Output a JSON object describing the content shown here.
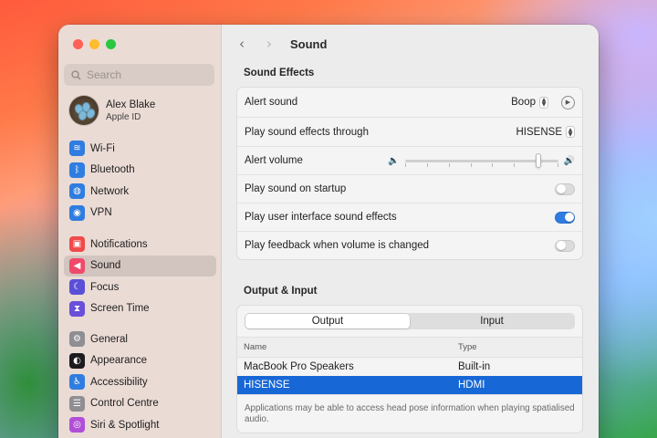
{
  "sidebar": {
    "search_placeholder": "Search",
    "account": {
      "name": "Alex Blake",
      "subtitle": "Apple ID"
    },
    "groups": [
      [
        {
          "label": "Wi-Fi",
          "icon": "wifi-icon",
          "color": "#2f7de1",
          "glyph": "≋"
        },
        {
          "label": "Bluetooth",
          "icon": "bluetooth-icon",
          "color": "#2f7de1",
          "glyph": "ᛒ"
        },
        {
          "label": "Network",
          "icon": "network-icon",
          "color": "#2f7de1",
          "glyph": "◍"
        },
        {
          "label": "VPN",
          "icon": "vpn-icon",
          "color": "#2f7de1",
          "glyph": "◉"
        }
      ],
      [
        {
          "label": "Notifications",
          "icon": "notifications-icon",
          "color": "#f04a4a",
          "glyph": "▣"
        },
        {
          "label": "Sound",
          "icon": "sound-icon",
          "color": "#f04a6a",
          "glyph": "◀",
          "active": true
        },
        {
          "label": "Focus",
          "icon": "focus-icon",
          "color": "#5b4fd8",
          "glyph": "☾"
        },
        {
          "label": "Screen Time",
          "icon": "screen-time-icon",
          "color": "#6a4fd8",
          "glyph": "⧗"
        }
      ],
      [
        {
          "label": "General",
          "icon": "general-icon",
          "color": "#8e8e93",
          "glyph": "⚙"
        },
        {
          "label": "Appearance",
          "icon": "appearance-icon",
          "color": "#1c1c1e",
          "glyph": "◐"
        },
        {
          "label": "Accessibility",
          "icon": "accessibility-icon",
          "color": "#2f7de1",
          "glyph": "♿"
        },
        {
          "label": "Control Centre",
          "icon": "control-centre-icon",
          "color": "#8e8e93",
          "glyph": "☰"
        },
        {
          "label": "Siri & Spotlight",
          "icon": "siri-icon",
          "color": "#b04fd8",
          "glyph": "◎"
        }
      ]
    ]
  },
  "main": {
    "title": "Sound",
    "sound_effects": {
      "section_title": "Sound Effects",
      "alert_sound_label": "Alert sound",
      "alert_sound_value": "Boop",
      "output_label": "Play sound effects through",
      "output_value": "HISENSE",
      "alert_volume_label": "Alert volume",
      "alert_volume_level": 0.88,
      "startup_label": "Play sound on startup",
      "startup_on": false,
      "ui_effects_label": "Play user interface sound effects",
      "ui_effects_on": true,
      "feedback_label": "Play feedback when volume is changed",
      "feedback_on": false
    },
    "output_input": {
      "section_title": "Output & Input",
      "tabs": [
        "Output",
        "Input"
      ],
      "selected_tab": "Output",
      "columns": [
        "Name",
        "Type"
      ],
      "rows": [
        {
          "name": "MacBook Pro Speakers",
          "type": "Built-in",
          "selected": false
        },
        {
          "name": "HISENSE",
          "type": "HDMI",
          "selected": true
        }
      ],
      "note": "Applications may be able to access head pose information when playing spatialised audio."
    }
  },
  "colors": {
    "accent": "#1767d6",
    "toggle_on": "#2f7de1"
  }
}
